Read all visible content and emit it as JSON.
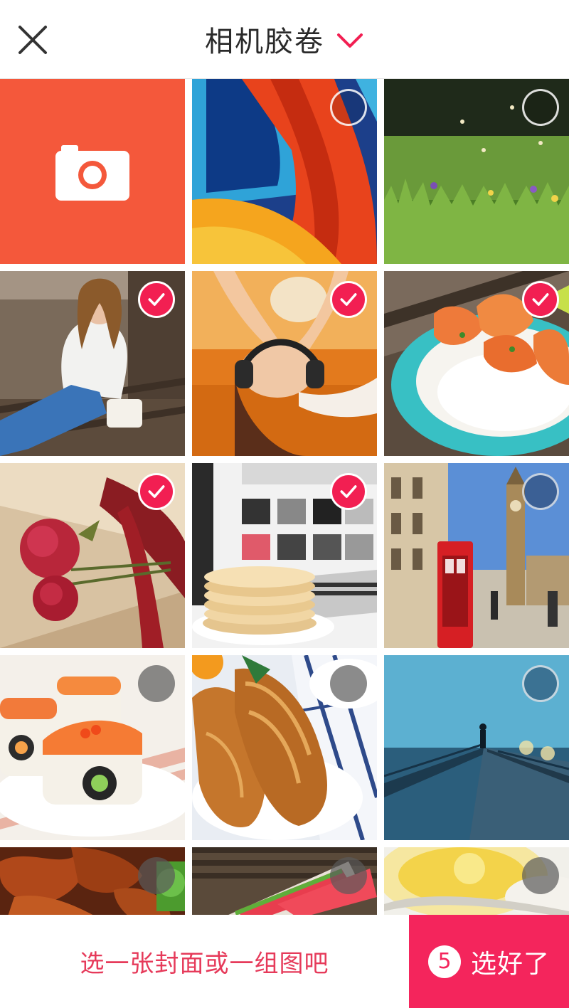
{
  "header": {
    "title": "相机胶卷",
    "close_icon": "close-icon",
    "dropdown_icon": "chevron-down-icon"
  },
  "colors": {
    "accent": "#f21f52",
    "camera_tile": "#f4583b",
    "done_button": "#f4255c"
  },
  "grid": {
    "camera_tile_icon": "camera-icon",
    "photos": [
      {
        "subject": "abstract-swirl",
        "selected": false
      },
      {
        "subject": "meadow-flowers",
        "selected": false
      },
      {
        "subject": "woman-on-bench",
        "selected": true
      },
      {
        "subject": "girl-with-headphones",
        "selected": true
      },
      {
        "subject": "shrimp-rice-plate",
        "selected": true
      },
      {
        "subject": "rose-and-ribbon",
        "selected": true
      },
      {
        "subject": "pancake-stack",
        "selected": true
      },
      {
        "subject": "london-phone-booth",
        "selected": false
      },
      {
        "subject": "salmon-sushi",
        "selected": false
      },
      {
        "subject": "croissants",
        "selected": false
      },
      {
        "subject": "foggy-pier",
        "selected": false
      },
      {
        "subject": "grilled-meat",
        "selected": false
      },
      {
        "subject": "watermelon-slices",
        "selected": false
      },
      {
        "subject": "lemon-drink",
        "selected": false
      }
    ]
  },
  "footer": {
    "hint": "选一张封面或一组图吧",
    "selected_count": "5",
    "done_label": "选好了"
  }
}
